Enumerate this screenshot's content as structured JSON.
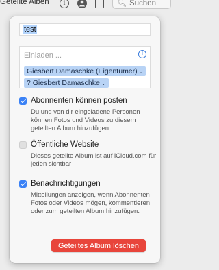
{
  "toolbar": {
    "title": "Geteilte Alben",
    "search_placeholder": "Suchen",
    "icons": [
      "info-icon",
      "people-icon",
      "share-icon",
      "search-icon"
    ]
  },
  "popover": {
    "album_name": "test",
    "invite": {
      "placeholder": "Einladen ...",
      "participants": [
        "Giesbert Damaschke (Eigentümer)",
        "? Giesbert Damaschke"
      ]
    },
    "options": [
      {
        "title": "Abonnenten können posten",
        "description": "Du und von dir eingeladene Personen können Fotos und Videos zu diesem geteilten Album hinzufügen.",
        "checked": true
      },
      {
        "title": "Öffentliche Website",
        "description": "Dieses geteilte Album ist auf iCloud.com für jeden sichtbar",
        "checked": false
      },
      {
        "title": "Benachrichtigungen",
        "description": "Mitteilungen anzeigen, wenn Abonnenten Fotos oder Videos mögen, kommentieren oder zum geteilten Album hinzufügen.",
        "checked": true
      }
    ],
    "delete_label": "Geteiltes Album löschen"
  },
  "colors": {
    "accent": "#3b82f6",
    "token_bg": "#b8d3f5",
    "danger": "#e8453b"
  }
}
